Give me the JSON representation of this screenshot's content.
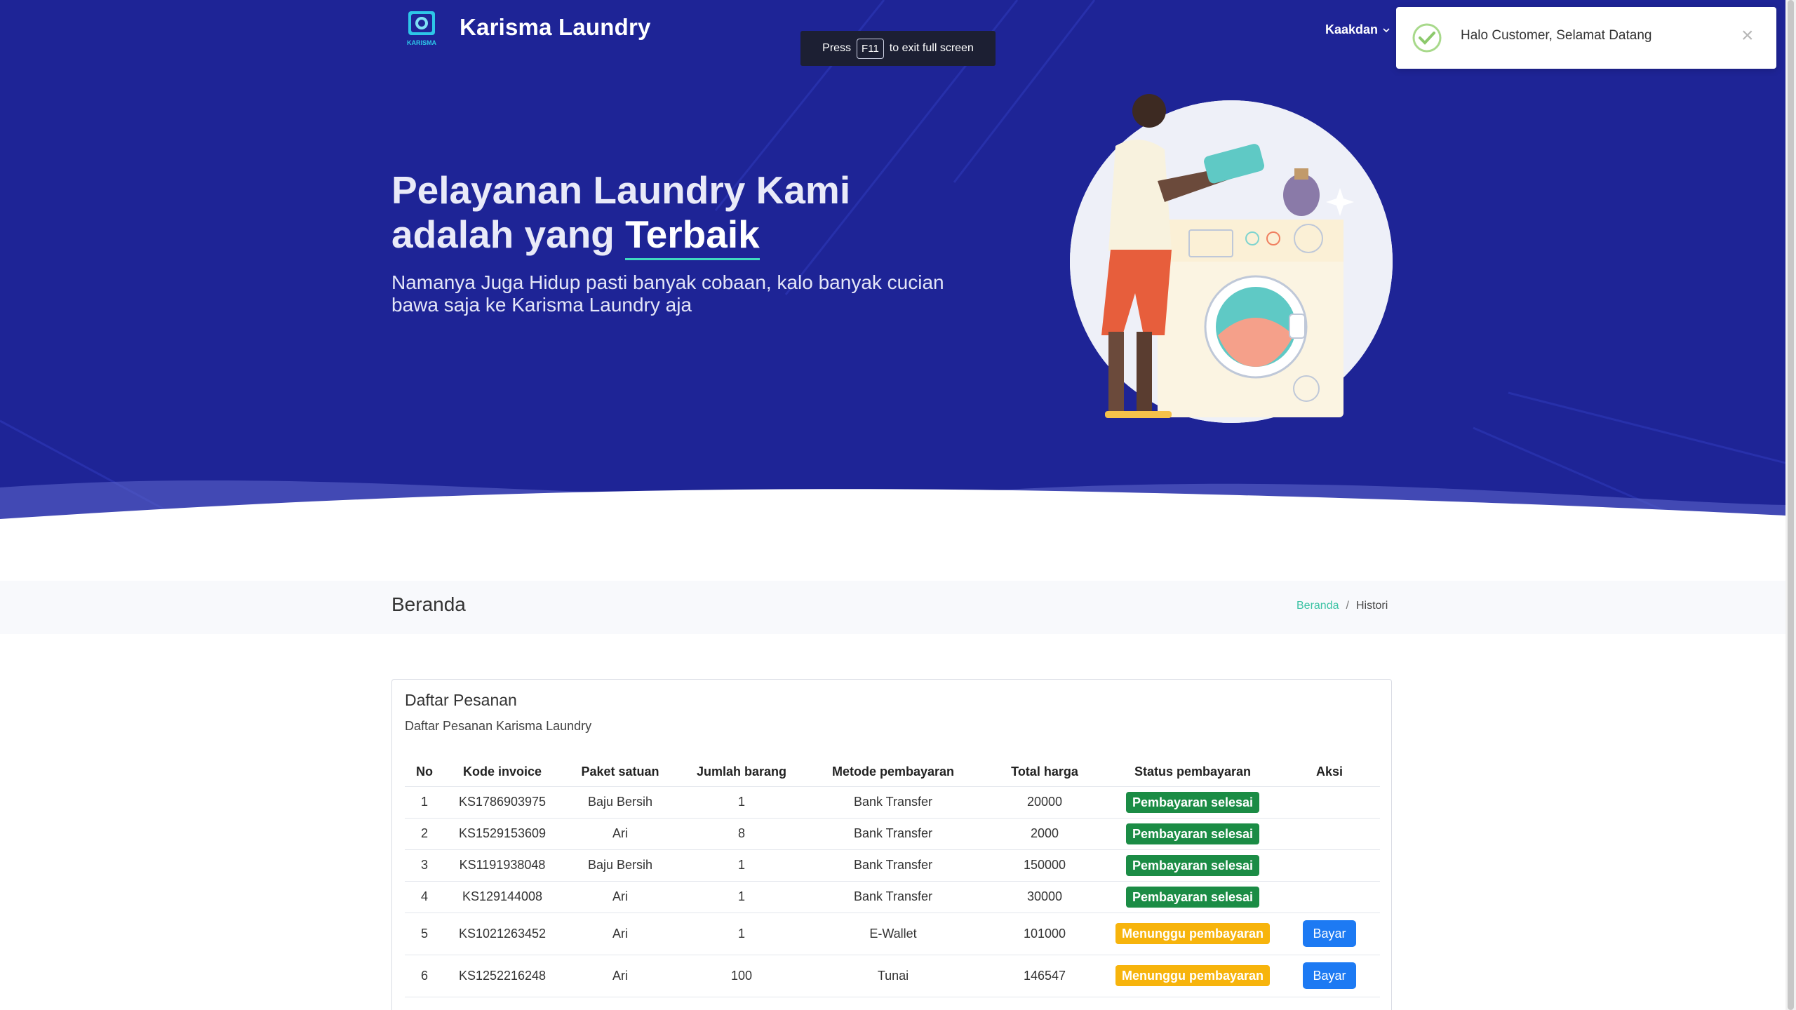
{
  "brand": {
    "name": "Karisma Laundry",
    "logo_text": "KARISMA"
  },
  "fullscreen_notice": {
    "before": "Press",
    "key": "F11",
    "after": "to exit full screen"
  },
  "user_menu": {
    "label": "Kaakdan"
  },
  "toast": {
    "message": "Halo Customer, Selamat Datang",
    "close": "×"
  },
  "hero": {
    "headline_line1": "Pelayanan Laundry Kami",
    "headline_line2_prefix": "adalah yang",
    "headline_emphasis": "Terbaik",
    "subline": "Namanya Juga Hidup pasti banyak cobaan, kalo banyak cucian bawa saja ke Karisma Laundry aja"
  },
  "page": {
    "title": "Beranda"
  },
  "breadcrumb": {
    "home": "Beranda",
    "separator": "/",
    "current": "Histori"
  },
  "card": {
    "title": "Daftar Pesanan",
    "subtitle": "Daftar Pesanan Karisma Laundry",
    "columns": [
      "No",
      "Kode invoice",
      "Paket satuan",
      "Jumlah barang",
      "Metode pembayaran",
      "Total harga",
      "Status pembayaran",
      "Aksi"
    ],
    "rows": [
      {
        "no": "1",
        "invoice": "KS1786903975",
        "paket": "Baju Bersih",
        "jumlah": "1",
        "metode": "Bank Transfer",
        "total": "20000",
        "status": "Pembayaran selesai",
        "status_type": "done",
        "aksi": ""
      },
      {
        "no": "2",
        "invoice": "KS1529153609",
        "paket": "Ari",
        "jumlah": "8",
        "metode": "Bank Transfer",
        "total": "2000",
        "status": "Pembayaran selesai",
        "status_type": "done",
        "aksi": ""
      },
      {
        "no": "3",
        "invoice": "KS1191938048",
        "paket": "Baju Bersih",
        "jumlah": "1",
        "metode": "Bank Transfer",
        "total": "150000",
        "status": "Pembayaran selesai",
        "status_type": "done",
        "aksi": ""
      },
      {
        "no": "4",
        "invoice": "KS129144008",
        "paket": "Ari",
        "jumlah": "1",
        "metode": "Bank Transfer",
        "total": "30000",
        "status": "Pembayaran selesai",
        "status_type": "done",
        "aksi": ""
      },
      {
        "no": "5",
        "invoice": "KS1021263452",
        "paket": "Ari",
        "jumlah": "1",
        "metode": "E-Wallet",
        "total": "101000",
        "status": "Menunggu pembayaran",
        "status_type": "wait",
        "aksi": "Bayar"
      },
      {
        "no": "6",
        "invoice": "KS1252216248",
        "paket": "Ari",
        "jumlah": "100",
        "metode": "Tunai",
        "total": "146547",
        "status": "Menunggu pembayaran",
        "status_type": "wait",
        "aksi": "Bayar"
      }
    ]
  },
  "colors": {
    "hero_bg": "#1e2496",
    "accent": "#3fd9c0",
    "status_done": "#1b8c45",
    "status_wait": "#f7b40c",
    "pay_button": "#1d7af3"
  }
}
